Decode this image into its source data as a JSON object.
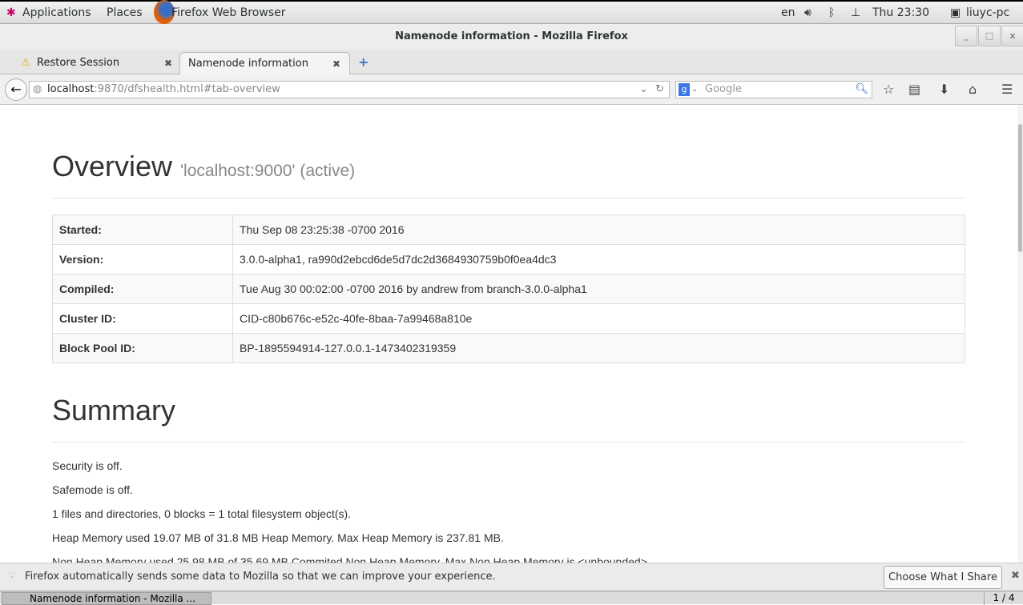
{
  "topbar": {
    "applications": "Applications",
    "places": "Places",
    "app": "Firefox Web Browser",
    "lang": "en",
    "clock": "Thu 23:30",
    "user": "liuyc-pc"
  },
  "window": {
    "title": "Namenode information - Mozilla Firefox"
  },
  "tabs": [
    {
      "label": "Restore Session",
      "icon": "warning-icon"
    },
    {
      "label": "Namenode information",
      "active": true
    }
  ],
  "nav": {
    "url_host": "localhost",
    "url_rest": ":9870/dfshealth.html#tab-overview",
    "search_placeholder": "Google"
  },
  "overview": {
    "title": "Overview",
    "subtitle": "'localhost:9000' (active)",
    "rows": [
      {
        "k": "Started:",
        "v": "Thu Sep 08 23:25:38 -0700 2016"
      },
      {
        "k": "Version:",
        "v": "3.0.0-alpha1, ra990d2ebcd6de5d7dc2d3684930759b0f0ea4dc3"
      },
      {
        "k": "Compiled:",
        "v": "Tue Aug 30 00:02:00 -0700 2016 by andrew from branch-3.0.0-alpha1"
      },
      {
        "k": "Cluster ID:",
        "v": "CID-c80b676c-e52c-40fe-8baa-7a99468a810e"
      },
      {
        "k": "Block Pool ID:",
        "v": "BP-1895594914-127.0.0.1-1473402319359"
      }
    ]
  },
  "summary": {
    "title": "Summary",
    "lines": [
      "Security is off.",
      "Safemode is off.",
      "1 files and directories, 0 blocks = 1 total filesystem object(s).",
      "Heap Memory used 19.07 MB of 31.8 MB Heap Memory. Max Heap Memory is 237.81 MB.",
      "Non Heap Memory used 25.98 MB of 35.69 MB Commited Non Heap Memory. Max Non Heap Memory is <unbounded>."
    ]
  },
  "infobar": {
    "message": "Firefox automatically sends some data to Mozilla so that we can improve your experience.",
    "button": "Choose What I Share"
  },
  "taskbar": {
    "item": "Namenode information - Mozilla ...",
    "workspace": "1 / 4"
  }
}
